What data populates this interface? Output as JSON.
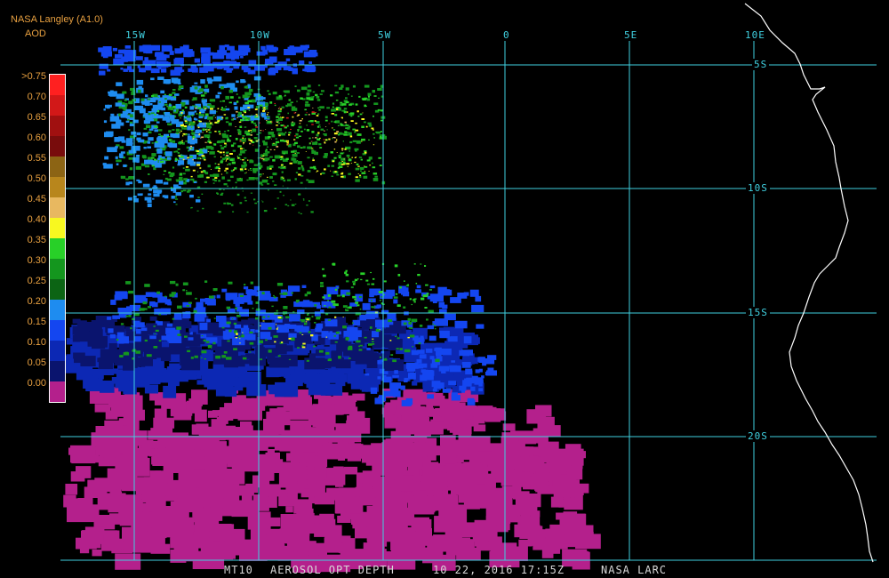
{
  "header": {
    "source": "NASA Langley (A1.0)",
    "variable": "AOD"
  },
  "legend": [
    {
      "label": ">0.75",
      "color": "#ff2020"
    },
    {
      "label": "0.70",
      "color": "#d21818"
    },
    {
      "label": "0.65",
      "color": "#a01010"
    },
    {
      "label": "0.60",
      "color": "#780c0c"
    },
    {
      "label": "0.55",
      "color": "#8c6414"
    },
    {
      "label": "0.50",
      "color": "#b8861c"
    },
    {
      "label": "0.45",
      "color": "#e8b860"
    },
    {
      "label": "0.40",
      "color": "#f8f820"
    },
    {
      "label": "0.35",
      "color": "#28d028"
    },
    {
      "label": "0.30",
      "color": "#14961e"
    },
    {
      "label": "0.25",
      "color": "#0c6414"
    },
    {
      "label": "0.20",
      "color": "#1e8cf0"
    },
    {
      "label": "0.15",
      "color": "#1446f0"
    },
    {
      "label": "0.10",
      "color": "#0c28b4"
    },
    {
      "label": "0.05",
      "color": "#0a146e"
    },
    {
      "label": "0.00",
      "color": "#b4208c"
    }
  ],
  "longitude_labels": [
    "15W",
    "10W",
    "5W",
    "0",
    "5E",
    "10E"
  ],
  "latitude_labels": [
    "5S",
    "10S",
    "15S",
    "20S"
  ],
  "footer": {
    "product": "MT10",
    "title": "AEROSOL OPT DEPTH",
    "datetime": "10 22, 2016 17:15Z",
    "credit": "NASA LARC"
  },
  "colors": {
    "grid": "#40d0e0",
    "coast": "#ffffff",
    "header_text": "#e8a040",
    "footer_text": "#d8d8d8"
  }
}
